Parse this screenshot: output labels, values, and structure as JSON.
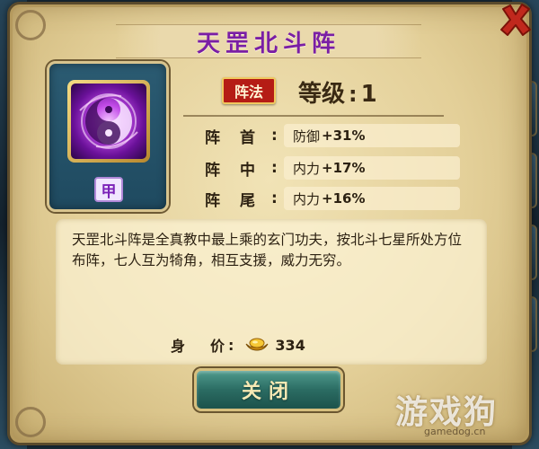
{
  "dialog": {
    "title": "天罡北斗阵",
    "grade_badge": "甲",
    "category_seal": "阵法",
    "level_label": "等级",
    "level_colon": ":",
    "level_value": "1"
  },
  "stats": [
    {
      "label": "阵首",
      "colon": ":",
      "attribute": "防御",
      "amount": "+31%"
    },
    {
      "label": "阵中",
      "colon": ":",
      "attribute": "内力",
      "amount": "+17%"
    },
    {
      "label": "阵尾",
      "colon": ":",
      "attribute": "内力",
      "amount": "+16%"
    }
  ],
  "description": "天罡北斗阵是全真教中最上乘的玄门功夫，按北斗七星所处方位布阵，七人互为犄角，相互支援，威力无穷。",
  "price": {
    "label": "身价",
    "colon": ":",
    "value": "334",
    "icon": "gold-ingot-icon"
  },
  "buttons": {
    "close_label": "关闭"
  },
  "watermark": {
    "text": "游戏狗",
    "url": "gamedog.cn"
  },
  "colors": {
    "title": "#7a1ea5",
    "parchment": "#e3cf98",
    "seal": "#b51c15",
    "close_x": "#c0281d",
    "button_teal": "#2b6c63"
  }
}
